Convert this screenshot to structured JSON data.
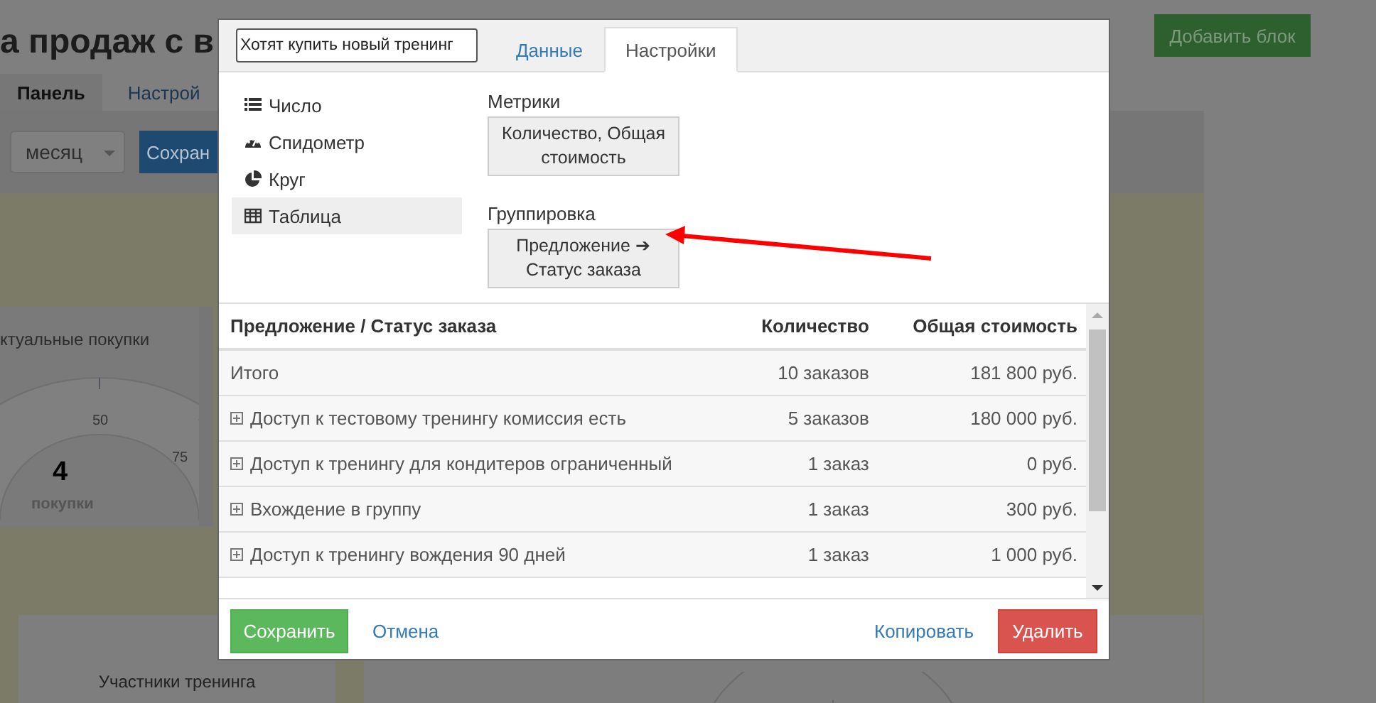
{
  "page": {
    "title": "а продаж с в",
    "add_button": "Добавить блок",
    "tabs": [
      {
        "label": "Панель",
        "selected": true
      },
      {
        "label": "Настрой",
        "selected": false
      }
    ],
    "period_select": "месяц",
    "save_button": "Сохран",
    "widget": {
      "title": "ктуальные покупки",
      "gauge_labels": [
        "50",
        "75"
      ],
      "value": "4",
      "unit": "покупки"
    },
    "bottom_card": {
      "title": "Участники тренинга"
    }
  },
  "dialog": {
    "name_value": "Хотят купить новый тренинг",
    "tabs": [
      {
        "label": "Данные",
        "selected": false
      },
      {
        "label": "Настройки",
        "selected": true
      }
    ],
    "views": [
      {
        "kind": "list",
        "label": "Число",
        "selected": false
      },
      {
        "kind": "gauge",
        "label": "Спидометр",
        "selected": false
      },
      {
        "kind": "pie",
        "label": "Круг",
        "selected": false
      },
      {
        "kind": "table",
        "label": "Таблица",
        "selected": true
      }
    ],
    "metrics": {
      "label": "Метрики",
      "value": "Количество, Общая стоимость"
    },
    "grouping": {
      "label": "Группировка",
      "value": "Предложение ➔ Статус заказа"
    },
    "table": {
      "columns": [
        "Предложение / Статус заказа",
        "Количество",
        "Общая стоимость"
      ],
      "rows": [
        {
          "expandable": false,
          "cells": [
            "Итого",
            "10 заказов",
            "181 800 руб."
          ]
        },
        {
          "expandable": true,
          "cells": [
            "Доступ к тестовому тренингу комиссия есть",
            "5 заказов",
            "180 000 руб."
          ]
        },
        {
          "expandable": true,
          "cells": [
            "Доступ к тренингу для кондитеров ограниченный",
            "1 заказ",
            "0 руб."
          ]
        },
        {
          "expandable": true,
          "cells": [
            "Вхождение в группу",
            "1 заказ",
            "300 руб."
          ]
        },
        {
          "expandable": true,
          "cells": [
            "Доступ к тренингу вождения 90 дней",
            "1 заказ",
            "1 000 руб."
          ]
        }
      ]
    },
    "buttons": {
      "save": "Сохранить",
      "cancel": "Отмена",
      "copy": "Копировать",
      "delete": "Удалить"
    }
  }
}
